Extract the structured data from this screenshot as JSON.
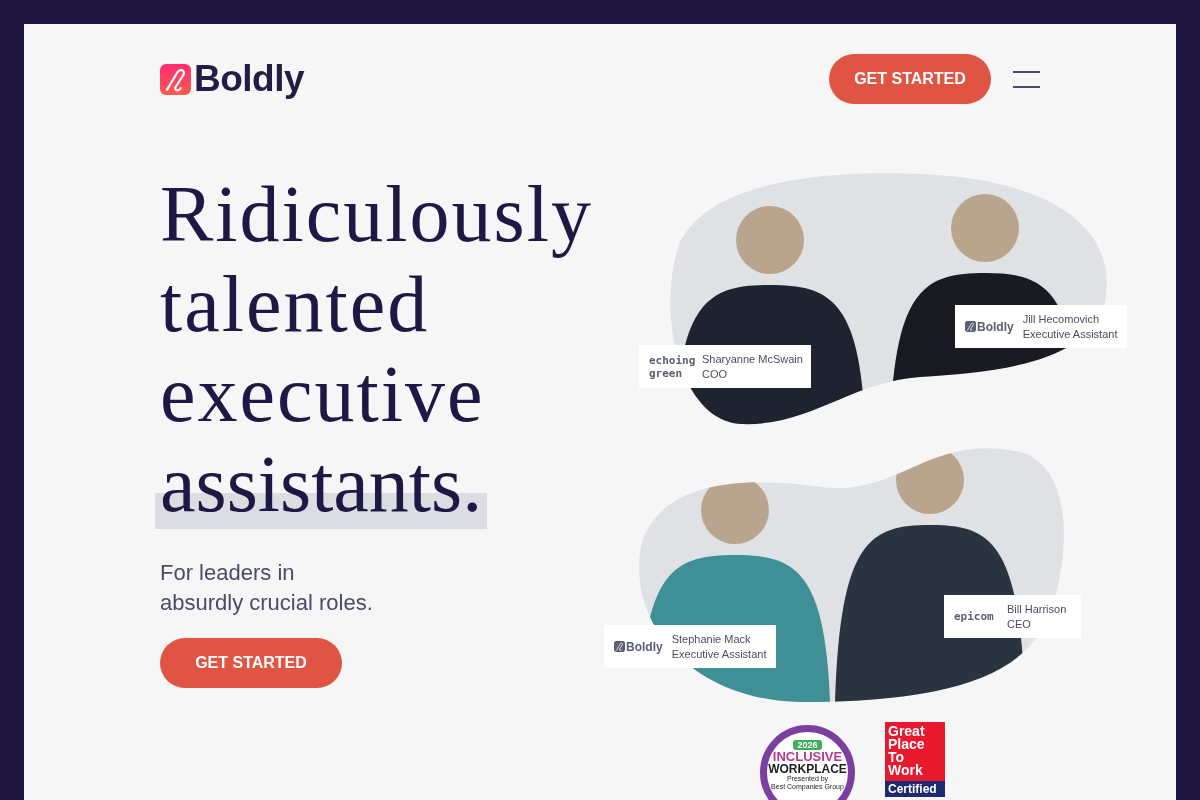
{
  "header": {
    "logo": "Boldly",
    "cta": "GET STARTED"
  },
  "hero": {
    "headline_lines": [
      "Ridiculously",
      "talented",
      "executive"
    ],
    "highlight": "assistants.",
    "subtitle_lines": [
      "For leaders in",
      "absurdly crucial roles."
    ],
    "cta": "GET STARTED"
  },
  "photo_groups": [
    {
      "captions": [
        {
          "kind": "wordmark",
          "logo": "echoing green",
          "name": "Sharyanne McSwain",
          "role": "COO"
        },
        {
          "kind": "boldly",
          "logo": "Boldly",
          "name": "Jill Hecomovich",
          "role": "Executive Assistant"
        }
      ]
    },
    {
      "captions": [
        {
          "kind": "boldly",
          "logo": "Boldly",
          "name": "Stephanie Mack",
          "role": "Executive Assistant"
        },
        {
          "kind": "wordmark",
          "logo": "epicom",
          "name": "Bill Harrison",
          "role": "CEO"
        }
      ]
    }
  ],
  "awards": {
    "inclusive": {
      "year": "2026",
      "line1": "INCLUSIVE",
      "line2": "WORKPLACE",
      "presented": "Presented by",
      "org": "Best Companies Group"
    },
    "gptw": {
      "title": "Great Place To Work",
      "label": "Certified"
    }
  }
}
